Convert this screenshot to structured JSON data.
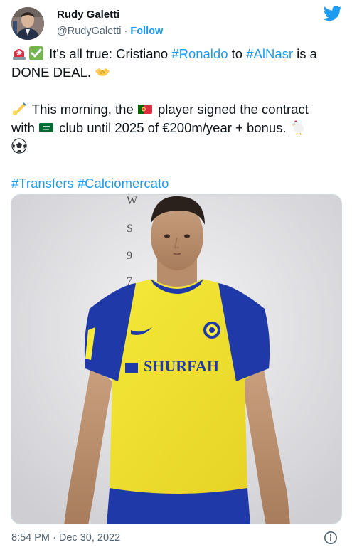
{
  "author": {
    "name": "Rudy Galetti",
    "handle": "@RudyGaletti",
    "separator": "·",
    "follow_label": "Follow"
  },
  "tweet": {
    "l1_text": " It's all true: Cristiano ",
    "l1_tag1": "#Ronaldo",
    "l1_mid": " to ",
    "l1_tag2": "#AlNasr",
    "l1_end": " is a",
    "l2_text": "DONE DEAL. ",
    "l3_text": " This morning, the ",
    "l3_end": " player signed the contract",
    "l4_start": "with ",
    "l4_text": " club until 2025 of €200m/year + bonus. ",
    "tag_transfers": "#Transfers",
    "tag_calcio": "#Calciomercato"
  },
  "media": {
    "shirt_sponsor": "SHURFAH",
    "wall_digits": [
      "W",
      "S",
      "9",
      "7"
    ]
  },
  "footer": {
    "timestamp": "8:54 PM · Dec 30, 2022"
  },
  "colors": {
    "link": "#1d9bf0",
    "shirt_yellow": "#f2e12f",
    "shirt_blue": "#1f3aa8"
  },
  "icons": {
    "brand": "twitter-bird-icon",
    "info": "info-icon"
  }
}
